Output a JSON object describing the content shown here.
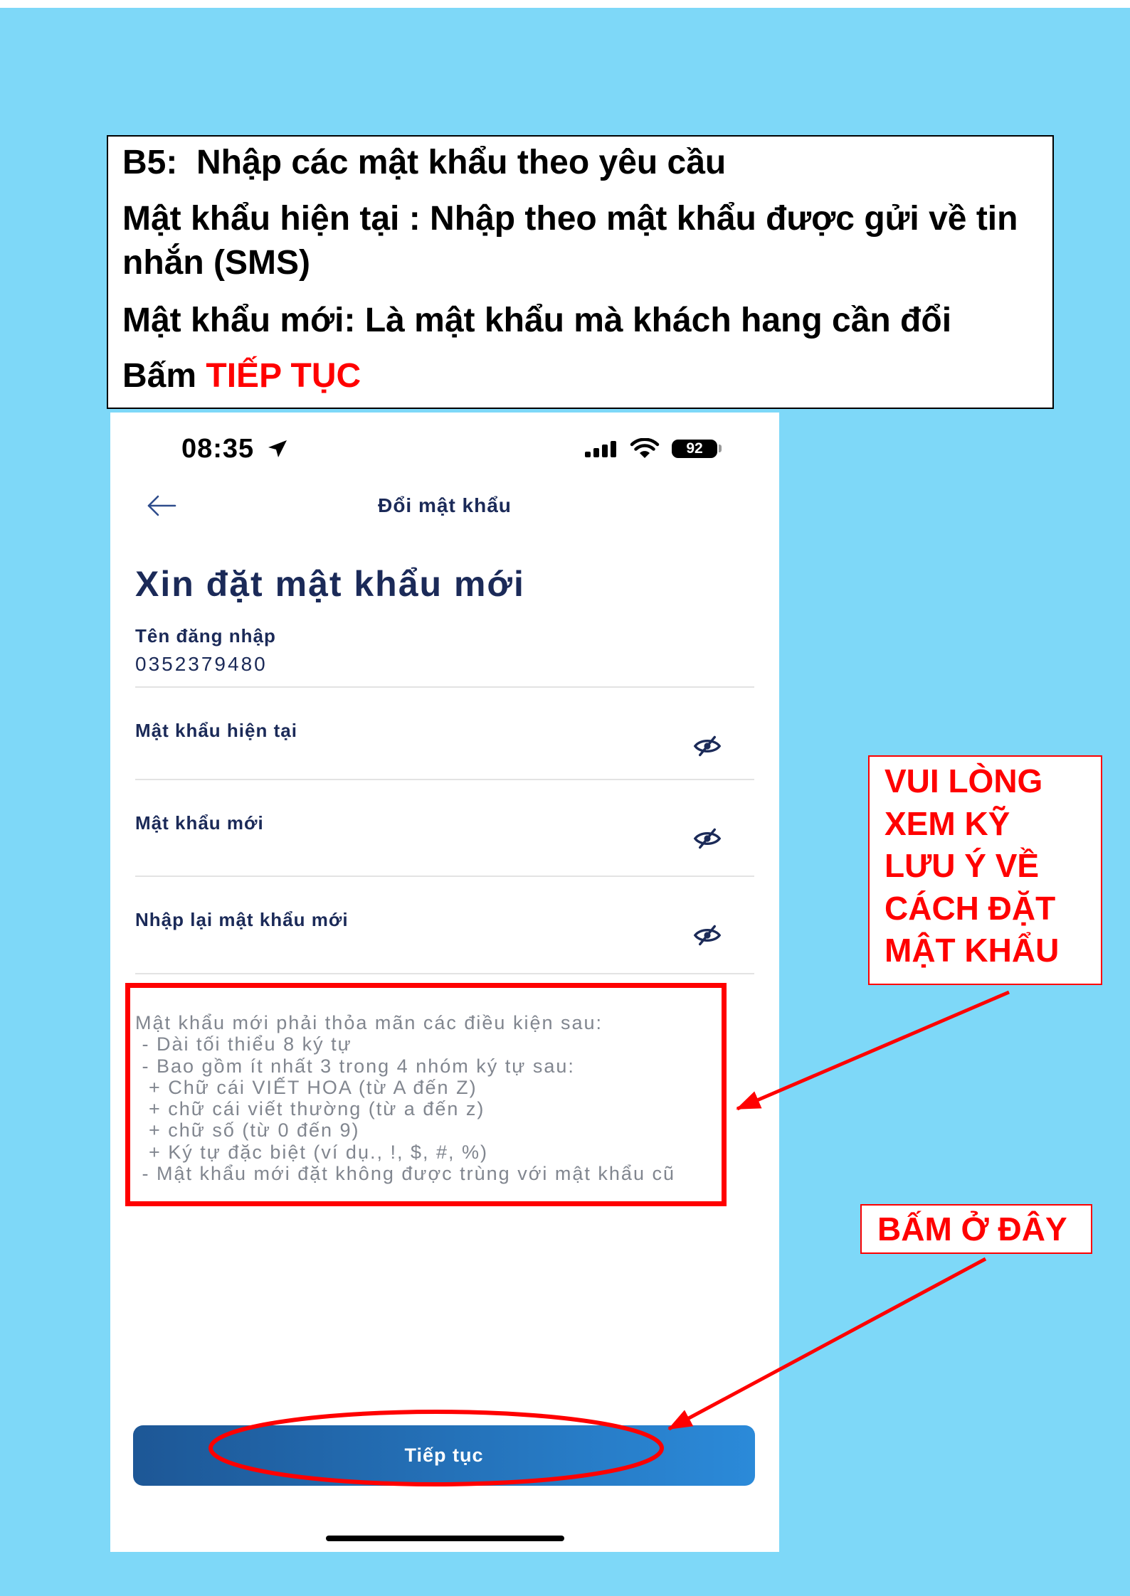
{
  "theme": {
    "page_background": "#7ed8f8",
    "app_text": "#1b2a58",
    "hint_text": "#81868f",
    "button_gradient_start": "#1d5796",
    "button_gradient_end": "#2b8ad9",
    "annotation": "#ff0000",
    "instruction_highlight": "#ff0000"
  },
  "instructions": {
    "step_title": "B5:  Nhập các mật khẩu theo yêu cầu",
    "current_password_note": "Mật khẩu hiện tại : Nhập theo mật khẩu được gửi về tin nhắn (SMS)",
    "new_password_note": "Mật khẩu mới: Là mật khẩu mà khách hang cần đổi",
    "press_prefix": "Bấm",
    "press_action": "TIẾP TỤC"
  },
  "status_bar": {
    "time": "08:35",
    "battery_level": "92",
    "icons": [
      "location-arrow-icon",
      "cellular-signal-icon",
      "wifi-icon",
      "battery-icon"
    ]
  },
  "nav": {
    "title": "Đổi mật khẩu",
    "back_icon": "arrow-left-icon"
  },
  "form": {
    "heading": "Xin đặt mật khẩu mới",
    "username": {
      "label": "Tên đăng nhập",
      "value": "0352379480"
    },
    "fields": [
      {
        "label": "Mật khẩu hiện tại",
        "toggle_icon": "eye-slash-icon"
      },
      {
        "label": "Mật khẩu mới",
        "toggle_icon": "eye-slash-icon"
      },
      {
        "label": "Nhập lại mật khẩu mới",
        "toggle_icon": "eye-slash-icon"
      }
    ],
    "requirements": [
      "Mật khẩu mới phải thỏa mãn các điều kiện sau:",
      " - Dài tối thiểu 8 ký tự",
      " - Bao gồm ít nhất 3 trong 4 nhóm ký tự sau:",
      "  + Chữ cái VIẾT HOA (từ A đến Z)",
      "  + chữ cái viết thường (từ a đến z)",
      "  + chữ số (từ 0 đến 9)",
      "  + Ký tự đặc biệt (ví dụ., !, $, #, %)",
      " - Mật khẩu mới đặt không được trùng với mật khẩu cũ"
    ],
    "submit_label": "Tiếp tục"
  },
  "annotations": {
    "review_note_lines": [
      "VUI LÒNG",
      "XEM KỸ",
      "LƯU Ý VỀ",
      "CÁCH ĐẶT",
      "MẬT KHẨU"
    ],
    "click_here": "BẤM Ở ĐÂY"
  }
}
